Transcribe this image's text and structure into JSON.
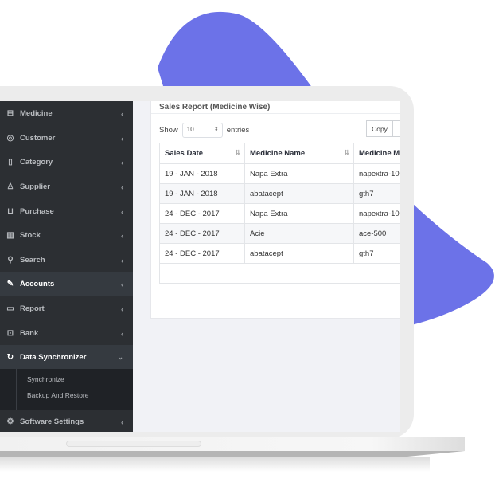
{
  "colors": {
    "accent_blob": "#6c72e8",
    "sidebar": "#2c2f33",
    "content": "#f1f2f6"
  },
  "sidebar": {
    "items": [
      {
        "label": "Medicine",
        "icon": "medicine-box-icon"
      },
      {
        "label": "Customer",
        "icon": "handshake-icon"
      },
      {
        "label": "Category",
        "icon": "tag-icon"
      },
      {
        "label": "Supplier",
        "icon": "user-icon"
      },
      {
        "label": "Purchase",
        "icon": "cart-icon"
      },
      {
        "label": "Stock",
        "icon": "bar-chart-icon"
      },
      {
        "label": "Search",
        "icon": "search-icon"
      },
      {
        "label": "Accounts",
        "icon": "edit-icon",
        "active": true
      },
      {
        "label": "Report",
        "icon": "book-icon"
      },
      {
        "label": "Bank",
        "icon": "briefcase-icon"
      },
      {
        "label": "Data Synchronizer",
        "icon": "sync-icon",
        "active": true,
        "expanded": true
      },
      {
        "label": "Software Settings",
        "icon": "gear-icon"
      }
    ],
    "submenu": [
      "Synchronize",
      "Backup And Restore"
    ]
  },
  "main": {
    "card_title": "Sales Report (Medicine Wise)",
    "show_label": "Show",
    "entries_label": "entries",
    "page_size": "10",
    "copy_button": "Copy",
    "table": {
      "headers": [
        "Sales Date",
        "Medicine Name",
        "Medicine M"
      ],
      "rows": [
        [
          "19 - JAN - 2018",
          "Napa Extra",
          "napextra-10"
        ],
        [
          "19 - JAN - 2018",
          "abatacept",
          "gth7"
        ],
        [
          "24 - DEC - 2017",
          "Napa Extra",
          "napextra-10"
        ],
        [
          "24 - DEC - 2017",
          "Acie",
          "ace-500"
        ],
        [
          "24 - DEC - 2017",
          "abatacept",
          "gth7"
        ]
      ]
    }
  }
}
